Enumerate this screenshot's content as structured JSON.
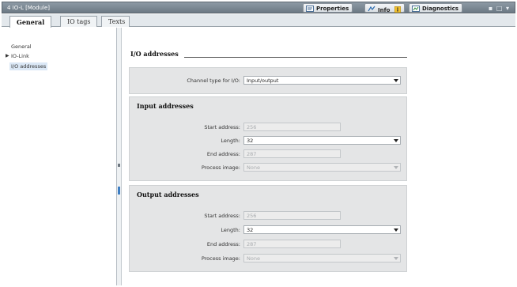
{
  "window": {
    "title": "4 IO-L [Module]",
    "tabs": [
      {
        "label": "Properties",
        "icon": "properties-icon"
      },
      {
        "label": "Info",
        "icon": "info-icon"
      },
      {
        "label": "Diagnostics",
        "icon": "diagnostics-icon"
      }
    ],
    "controls": "▪ □ ▾"
  },
  "tabs": [
    {
      "label": "General",
      "active": true
    },
    {
      "label": "IO tags",
      "active": false
    },
    {
      "label": "Texts",
      "active": false
    }
  ],
  "nav": {
    "items": [
      {
        "label": "General"
      },
      {
        "label": "IO-Link",
        "expandable": true
      },
      {
        "label": "I/O addresses",
        "selected": true
      }
    ]
  },
  "content": {
    "heading": "I/O addresses",
    "channel": {
      "label": "Channel type for I/O:",
      "value": "Input/output"
    },
    "input": {
      "title": "Input addresses",
      "start_label": "Start address:",
      "start_value": "256",
      "length_label": "Length:",
      "length_value": "32",
      "end_label": "End address:",
      "end_value": "287",
      "pi_label": "Process image:",
      "pi_value": "None"
    },
    "output": {
      "title": "Output addresses",
      "start_label": "Start address:",
      "start_value": "256",
      "length_label": "Length:",
      "length_value": "32",
      "end_label": "End address:",
      "end_value": "287",
      "pi_label": "Process image:",
      "pi_value": "None"
    }
  }
}
